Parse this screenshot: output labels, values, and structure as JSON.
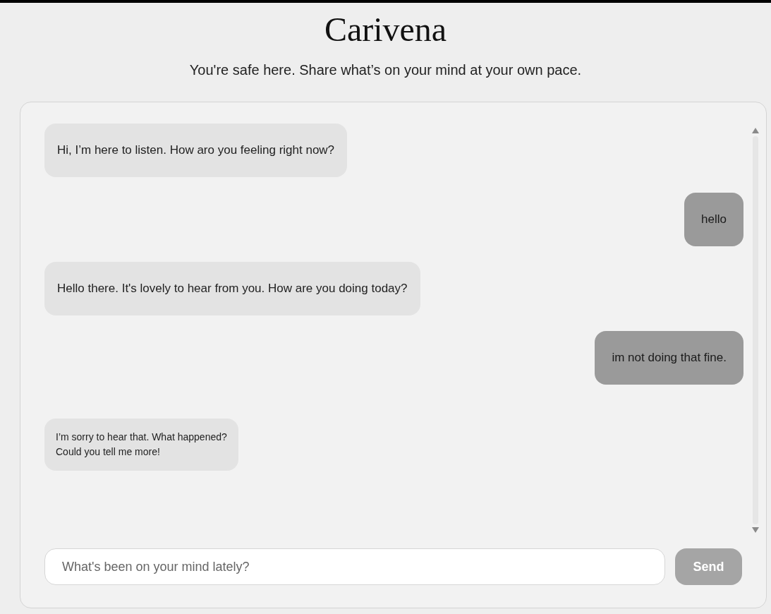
{
  "header": {
    "title": "Carivena",
    "subtitle": "You're safe here. Share what’s on your mind at your own pace."
  },
  "messages": [
    {
      "kind": "bot",
      "text": "Hi, I’m here to listen. How aro you feeling right now?",
      "compact": false
    },
    {
      "kind": "user",
      "text": "hello",
      "compact": false
    },
    {
      "kind": "bot",
      "text": "Hello there. It's lovely to hear from you. How are you doing today?",
      "compact": false
    },
    {
      "kind": "user",
      "text": "im not doing that fine.",
      "compact": false
    },
    {
      "kind": "bot",
      "text": "I’m sorry to hear that. What happened?\nCould you tell me more!",
      "compact": true
    }
  ],
  "composer": {
    "placeholder": "What's been on your mind lately?",
    "button": "Send"
  }
}
